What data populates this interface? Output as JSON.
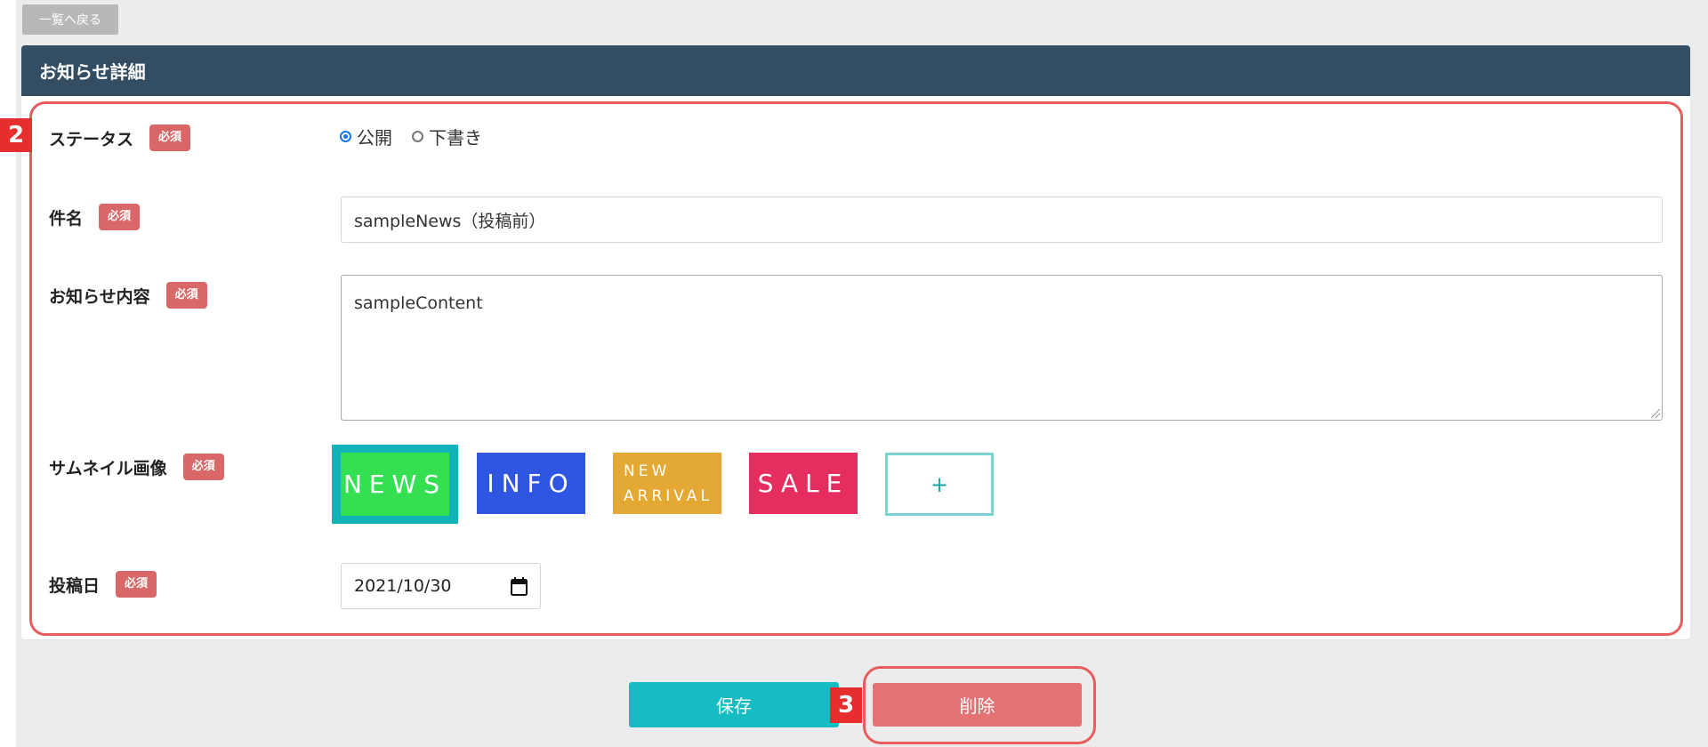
{
  "toolbar": {
    "back_label": "一覧へ戻る"
  },
  "card": {
    "title": "お知らせ詳細"
  },
  "steps": {
    "form": "2",
    "delete": "3"
  },
  "fields": {
    "status": {
      "label": "ステータス",
      "required": "必須",
      "options": [
        {
          "label": "公開",
          "selected": true
        },
        {
          "label": "下書き",
          "selected": false
        }
      ]
    },
    "subject": {
      "label": "件名",
      "required": "必須",
      "value": "sampleNews（投稿前）"
    },
    "content": {
      "label": "お知らせ内容",
      "required": "必須",
      "value": "sampleContent"
    },
    "thumbnail": {
      "label": "サムネイル画像",
      "required": "必須",
      "items": [
        {
          "text": "NEWS",
          "color": "#34e052",
          "selected": true
        },
        {
          "text": "INFO",
          "color": "#2f56e0",
          "selected": false
        },
        {
          "line1": "NEW",
          "line2": "ARRIVAL",
          "color": "#e4a935",
          "selected": false
        },
        {
          "text": "SALE",
          "color": "#e52d5f",
          "selected": false
        }
      ],
      "add_label": "+"
    },
    "post_date": {
      "label": "投稿日",
      "required": "必須",
      "value": "2021/10/30"
    }
  },
  "actions": {
    "save_label": "保存",
    "delete_label": "削除"
  },
  "colors": {
    "header": "#334e62",
    "accent": "#16bcc3",
    "danger": "#e57373",
    "highlight": "#e85c5c"
  }
}
